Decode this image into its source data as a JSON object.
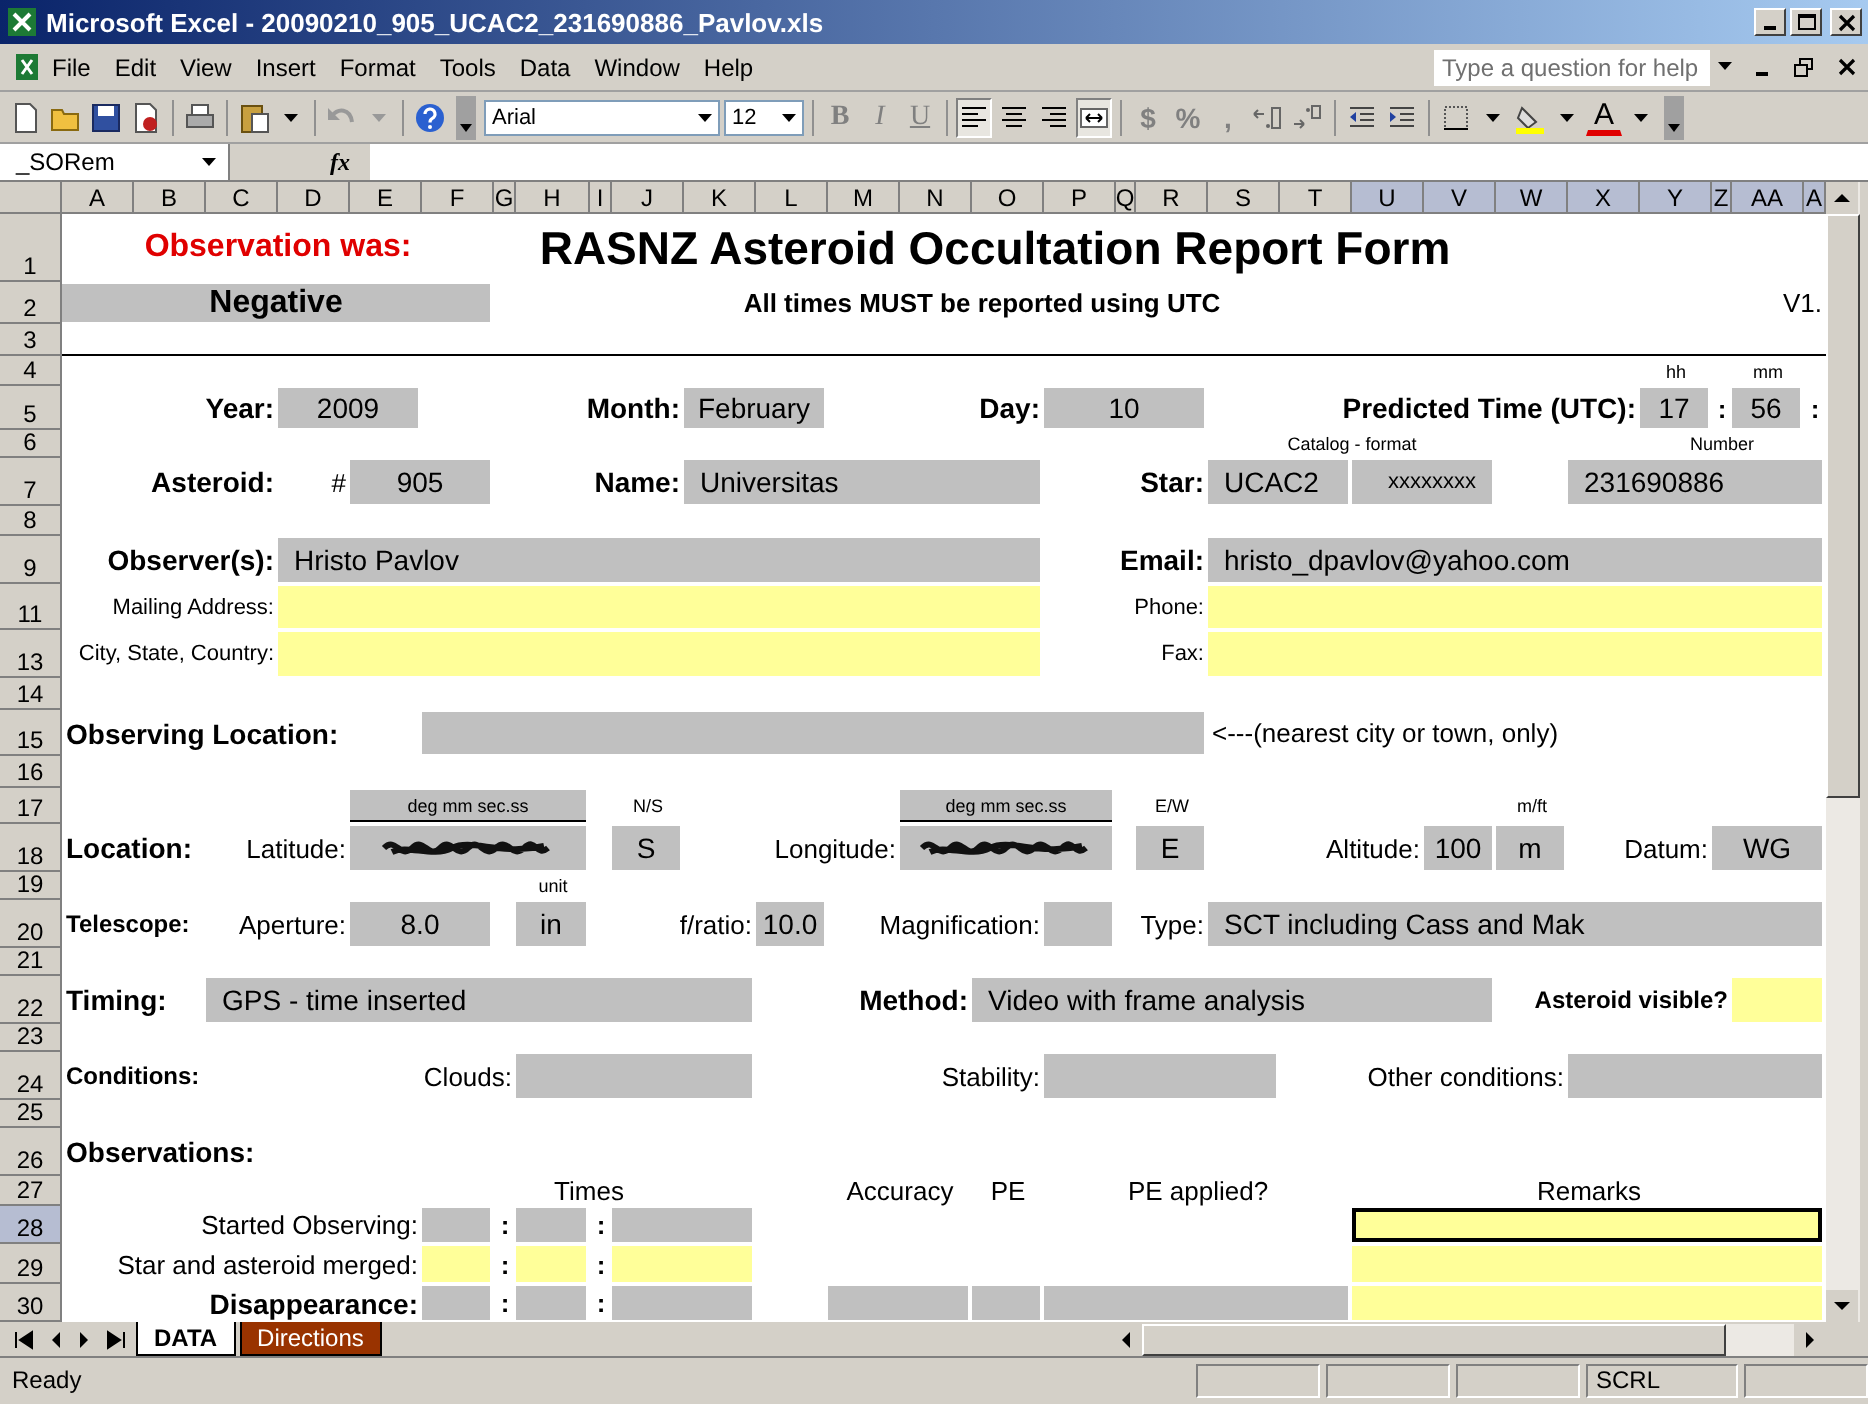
{
  "window": {
    "title": "Microsoft Excel - 20090210_905_UCAC2_231690886_Pavlov.xls"
  },
  "menu": [
    "File",
    "Edit",
    "View",
    "Insert",
    "Format",
    "Tools",
    "Data",
    "Window",
    "Help"
  ],
  "help_search": {
    "placeholder": "Type a question for help"
  },
  "toolbar": {
    "font": "Arial",
    "size": "12",
    "styles": [
      "B",
      "I",
      "U"
    ],
    "alignment": [
      {
        "kind": "left",
        "selected": true
      },
      {
        "kind": "center",
        "selected": false
      },
      {
        "kind": "right",
        "selected": false
      },
      {
        "kind": "merge",
        "selected": true
      }
    ],
    "number_formats": [
      "$",
      "%",
      ","
    ],
    "font_color": "A"
  },
  "name_box": "_SORem",
  "function_label": "fx",
  "columns": [
    {
      "label": "A",
      "selected": false
    },
    {
      "label": "B",
      "selected": false
    },
    {
      "label": "C",
      "selected": false
    },
    {
      "label": "D",
      "selected": false
    },
    {
      "label": "E",
      "selected": false
    },
    {
      "label": "F",
      "selected": false
    },
    {
      "label": "G",
      "selected": false
    },
    {
      "label": "H",
      "selected": false
    },
    {
      "label": "I",
      "selected": false
    },
    {
      "label": "J",
      "selected": false
    },
    {
      "label": "K",
      "selected": false
    },
    {
      "label": "L",
      "selected": false
    },
    {
      "label": "M",
      "selected": false
    },
    {
      "label": "N",
      "selected": false
    },
    {
      "label": "O",
      "selected": false
    },
    {
      "label": "P",
      "selected": false
    },
    {
      "label": "Q",
      "selected": false
    },
    {
      "label": "R",
      "selected": false
    },
    {
      "label": "S",
      "selected": false
    },
    {
      "label": "T",
      "selected": false
    },
    {
      "label": "U",
      "selected": true
    },
    {
      "label": "V",
      "selected": true
    },
    {
      "label": "W",
      "selected": true
    },
    {
      "label": "X",
      "selected": true
    },
    {
      "label": "Y",
      "selected": true
    },
    {
      "label": "Z",
      "selected": true
    },
    {
      "label": "AA",
      "selected": true
    },
    {
      "label": "A",
      "selected": true
    }
  ],
  "rows": [
    {
      "label": "1",
      "selected": false
    },
    {
      "label": "2",
      "selected": false
    },
    {
      "label": "3",
      "selected": false
    },
    {
      "label": "4",
      "selected": false
    },
    {
      "label": "5",
      "selected": false
    },
    {
      "label": "6",
      "selected": false
    },
    {
      "label": "7",
      "selected": false
    },
    {
      "label": "8",
      "selected": false
    },
    {
      "label": "9",
      "selected": false
    },
    {
      "label": "11",
      "selected": false
    },
    {
      "label": "13",
      "selected": false
    },
    {
      "label": "14",
      "selected": false
    },
    {
      "label": "15",
      "selected": false
    },
    {
      "label": "16",
      "selected": false
    },
    {
      "label": "17",
      "selected": false
    },
    {
      "label": "18",
      "selected": false
    },
    {
      "label": "19",
      "selected": false
    },
    {
      "label": "20",
      "selected": false
    },
    {
      "label": "21",
      "selected": false
    },
    {
      "label": "22",
      "selected": false
    },
    {
      "label": "23",
      "selected": false
    },
    {
      "label": "24",
      "selected": false
    },
    {
      "label": "25",
      "selected": false
    },
    {
      "label": "26",
      "selected": false
    },
    {
      "label": "27",
      "selected": false
    },
    {
      "label": "28",
      "selected": true
    },
    {
      "label": "29",
      "selected": false
    },
    {
      "label": "30",
      "selected": false
    }
  ],
  "cells": [
    {
      "kind": "heading",
      "text": "Observation was:"
    },
    {
      "kind": "title",
      "text": "RASNZ Asteroid Occultation Report Form"
    },
    {
      "kind": "value-strong",
      "text": "Negative"
    },
    {
      "kind": "notice",
      "text": "All times MUST be reported using UTC"
    },
    {
      "kind": "caption",
      "text": "V1."
    },
    {
      "kind": "small",
      "text": "hh"
    },
    {
      "kind": "small",
      "text": "mm"
    },
    {
      "kind": "label",
      "text": "Year:"
    },
    {
      "kind": "value",
      "text": "2009"
    },
    {
      "kind": "label",
      "text": "Month:"
    },
    {
      "kind": "value",
      "text": "February"
    },
    {
      "kind": "label",
      "text": "Day:"
    },
    {
      "kind": "value",
      "text": "10"
    },
    {
      "kind": "label",
      "text": "Predicted Time (UTC):"
    },
    {
      "kind": "value",
      "text": "17"
    },
    {
      "kind": "colon",
      "text": ":"
    },
    {
      "kind": "value",
      "text": "56"
    },
    {
      "kind": "colon",
      "text": ":"
    },
    {
      "kind": "small",
      "text": "Catalog - format"
    },
    {
      "kind": "small",
      "text": "Number"
    },
    {
      "kind": "label",
      "text": "Asteroid:"
    },
    {
      "kind": "caption",
      "text": "#"
    },
    {
      "kind": "value",
      "text": "905"
    },
    {
      "kind": "label",
      "text": "Name:"
    },
    {
      "kind": "value",
      "text": "Universitas"
    },
    {
      "kind": "label",
      "text": "Star:"
    },
    {
      "kind": "value",
      "text": "UCAC2"
    },
    {
      "kind": "value-small",
      "text": "xxxxxxxx"
    },
    {
      "kind": "value",
      "text": "231690886"
    },
    {
      "kind": "label",
      "text": "Observer(s):"
    },
    {
      "kind": "value",
      "text": "Hristo Pavlov"
    },
    {
      "kind": "label",
      "text": "Email:"
    },
    {
      "kind": "value",
      "text": "hristo_dpavlov@yahoo.com"
    },
    {
      "kind": "small-caption",
      "text": "Mailing Address:"
    },
    {
      "kind": "input"
    },
    {
      "kind": "small-caption",
      "text": "Phone:"
    },
    {
      "kind": "input"
    },
    {
      "kind": "small-caption",
      "text": "City, State, Country:"
    },
    {
      "kind": "input"
    },
    {
      "kind": "small-caption",
      "text": "Fax:"
    },
    {
      "kind": "input"
    },
    {
      "kind": "label",
      "text": "Observing Location:"
    },
    {
      "kind": "value"
    },
    {
      "kind": "caption",
      "text": "<---(nearest city or town, only)"
    },
    {
      "kind": "unit-head",
      "text": "deg mm sec.ss"
    },
    {
      "kind": "small",
      "text": "N/S"
    },
    {
      "kind": "unit-head",
      "text": "deg mm sec.ss"
    },
    {
      "kind": "small",
      "text": "E/W"
    },
    {
      "kind": "small",
      "text": "m/ft"
    },
    {
      "kind": "label",
      "text": "Location:"
    },
    {
      "kind": "caption",
      "text": "Latitude:"
    },
    {
      "kind": "redacted"
    },
    {
      "kind": "value",
      "text": "S"
    },
    {
      "kind": "caption",
      "text": "Longitude:"
    },
    {
      "kind": "redacted"
    },
    {
      "kind": "value",
      "text": "E"
    },
    {
      "kind": "caption",
      "text": "Altitude:"
    },
    {
      "kind": "value",
      "text": "100"
    },
    {
      "kind": "value",
      "text": "m"
    },
    {
      "kind": "caption",
      "text": "Datum:"
    },
    {
      "kind": "value",
      "text": "WG"
    },
    {
      "kind": "small",
      "text": "unit"
    },
    {
      "kind": "label-small",
      "text": "Telescope:"
    },
    {
      "kind": "caption",
      "text": "Aperture:"
    },
    {
      "kind": "value",
      "text": "8.0"
    },
    {
      "kind": "value",
      "text": "in"
    },
    {
      "kind": "caption",
      "text": "f/ratio:"
    },
    {
      "kind": "value",
      "text": "10.0"
    },
    {
      "kind": "caption",
      "text": "Magnification:"
    },
    {
      "kind": "value"
    },
    {
      "kind": "caption",
      "text": "Type:"
    },
    {
      "kind": "value",
      "text": "SCT including Cass and Mak"
    },
    {
      "kind": "label",
      "text": "Timing:"
    },
    {
      "kind": "value",
      "text": "GPS - time inserted"
    },
    {
      "kind": "label",
      "text": "Method:"
    },
    {
      "kind": "value",
      "text": "Video with frame analysis"
    },
    {
      "kind": "label-small",
      "text": "Asteroid visible?"
    },
    {
      "kind": "input"
    },
    {
      "kind": "label-small",
      "text": "Conditions:"
    },
    {
      "kind": "caption",
      "text": "Clouds:"
    },
    {
      "kind": "value"
    },
    {
      "kind": "caption",
      "text": "Stability:"
    },
    {
      "kind": "value"
    },
    {
      "kind": "caption",
      "text": "Other conditions:"
    },
    {
      "kind": "value"
    },
    {
      "kind": "label",
      "text": "Observations:"
    },
    {
      "kind": "caption",
      "text": "Times"
    },
    {
      "kind": "caption",
      "text": "Accuracy"
    },
    {
      "kind": "caption",
      "text": "PE"
    },
    {
      "kind": "caption",
      "text": "PE applied?"
    },
    {
      "kind": "caption",
      "text": "Remarks"
    },
    {
      "kind": "caption",
      "text": "Started Observing:"
    },
    {
      "kind": "value"
    },
    {
      "kind": "colon",
      "text": ":"
    },
    {
      "kind": "value"
    },
    {
      "kind": "colon",
      "text": ":"
    },
    {
      "kind": "value"
    },
    {
      "kind": "input",
      "active": true
    },
    {
      "kind": "caption",
      "text": "Star and asteroid merged:"
    },
    {
      "kind": "input"
    },
    {
      "kind": "colon",
      "text": ":"
    },
    {
      "kind": "input"
    },
    {
      "kind": "colon",
      "text": ":"
    },
    {
      "kind": "input"
    },
    {
      "kind": "input"
    },
    {
      "kind": "label",
      "text": "Disappearance:"
    },
    {
      "kind": "value"
    },
    {
      "kind": "colon",
      "text": ":"
    },
    {
      "kind": "value"
    },
    {
      "kind": "colon",
      "text": ":"
    },
    {
      "kind": "value"
    },
    {
      "kind": "value"
    },
    {
      "kind": "value"
    },
    {
      "kind": "value"
    },
    {
      "kind": "input"
    }
  ],
  "sheet_tabs": [
    {
      "label": "DATA",
      "selected": true,
      "color": "#ffffff"
    },
    {
      "label": "Directions",
      "selected": false,
      "color": "#993300"
    }
  ],
  "status_bar": {
    "text": "Ready",
    "indicator": "SCRL"
  }
}
